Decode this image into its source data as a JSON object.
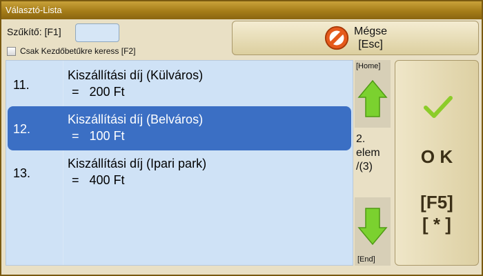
{
  "window": {
    "title": "Választó-Lista"
  },
  "filter": {
    "label": "Szűkítő: [F1]",
    "value": ""
  },
  "checkbox": {
    "label": "Csak Kezdőbetűkre keress [F2]",
    "checked": false
  },
  "cancel_button": {
    "line1": "Mégse",
    "line2": "[Esc]",
    "icon": "no-entry-icon"
  },
  "list": {
    "items": [
      {
        "number": "11.",
        "name": "Kiszállítási díj (Külváros)",
        "price": "=   200 Ft",
        "selected": false
      },
      {
        "number": "12.",
        "name": "Kiszállítási díj (Belváros)",
        "price": "=   100 Ft",
        "selected": true
      },
      {
        "number": "13.",
        "name": "Kiszállítási díj (Ipari park)",
        "price": "=   400 Ft",
        "selected": false
      }
    ]
  },
  "nav": {
    "home_label": "[Home]",
    "end_label": "[End]",
    "position_line1": "2.",
    "position_line2": "elem",
    "position_line3": "/(3)"
  },
  "ok_button": {
    "label": "O K",
    "key1": "[F5]",
    "key2": "[ * ]"
  },
  "colors": {
    "title_bar": "#a57c18",
    "selection": "#3b6fc4",
    "list_bg": "#cfe2f6",
    "arrow_green": "#7bd12f",
    "check_green": "#8ccc2a"
  }
}
